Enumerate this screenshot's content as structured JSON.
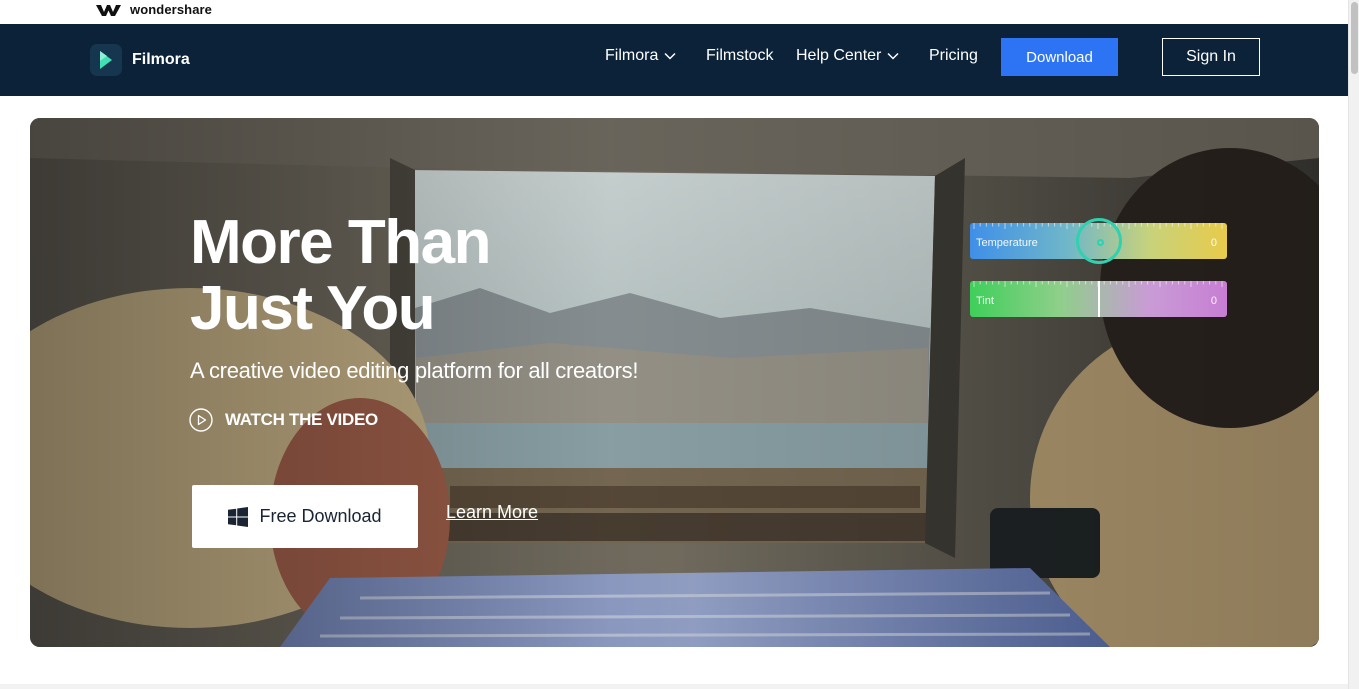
{
  "brand": {
    "company": "wondershare",
    "product": "Filmora"
  },
  "nav": {
    "items": [
      {
        "label": "Filmora",
        "has_dropdown": true
      },
      {
        "label": "Filmstock",
        "has_dropdown": false
      },
      {
        "label": "Help Center",
        "has_dropdown": true
      },
      {
        "label": "Pricing",
        "has_dropdown": false
      }
    ],
    "download_label": "Download",
    "signin_label": "Sign In"
  },
  "hero": {
    "title_line1": "More Than",
    "title_line2": "Just You",
    "subtitle": "A creative video editing platform for all creators!",
    "watch_label": "WATCH THE VIDEO",
    "free_download_label": "Free Download",
    "learn_more_label": "Learn More"
  },
  "sliders": {
    "temperature": {
      "label": "Temperature",
      "value": "0",
      "level": 0.5
    },
    "tint": {
      "label": "Tint",
      "value": "0",
      "level": 0.5
    }
  },
  "colors": {
    "nav_bg": "#0b2238",
    "download_btn": "#2d74f5",
    "knob_accent": "#2fd1b1",
    "text_on_dark": "#ffffff"
  },
  "icons": [
    "wondershare-logo-icon",
    "filmora-logo-icon",
    "chevron-down-icon",
    "play-circle-icon",
    "windows-icon"
  ]
}
